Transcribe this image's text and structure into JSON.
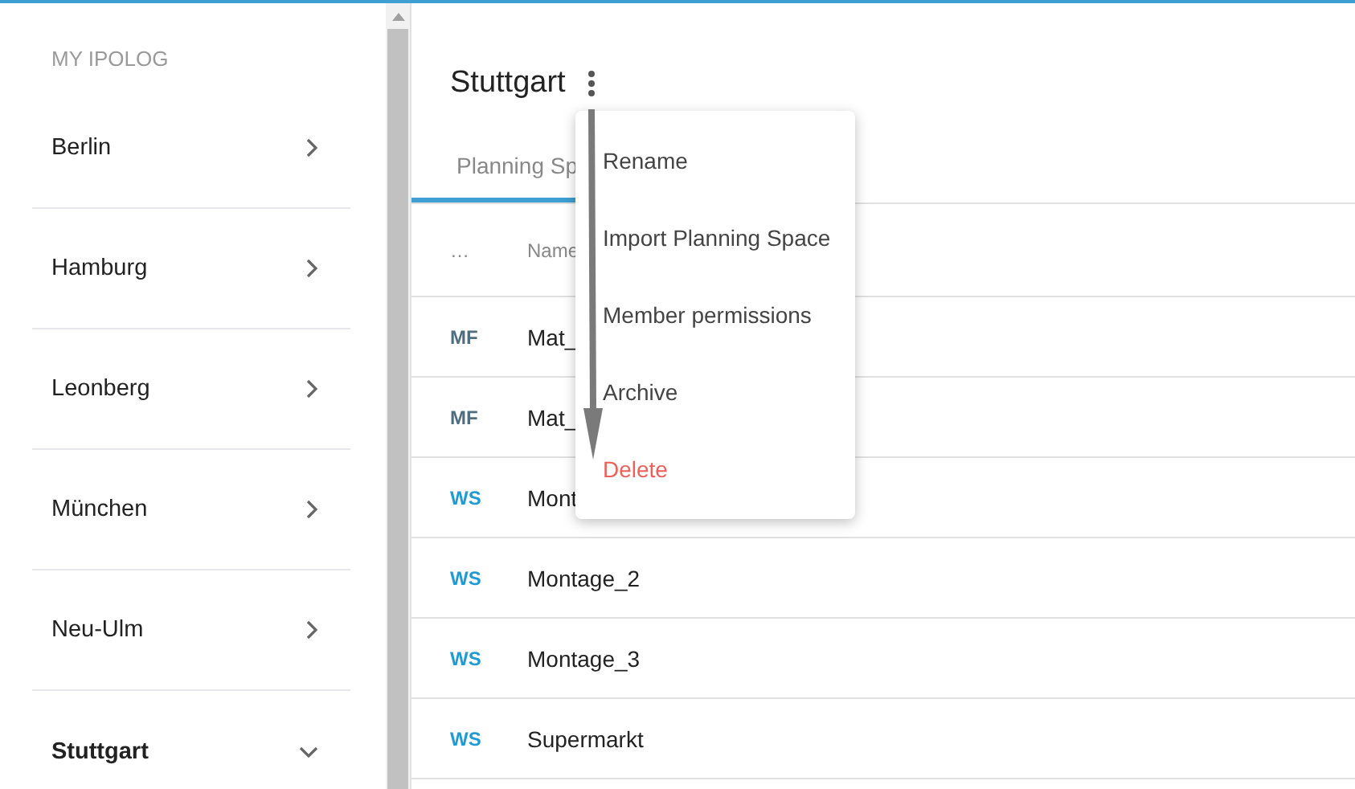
{
  "sidebar": {
    "heading": "MY IPOLOG",
    "items": [
      {
        "label": "Berlin",
        "expanded": false
      },
      {
        "label": "Hamburg",
        "expanded": false
      },
      {
        "label": "Leonberg",
        "expanded": false
      },
      {
        "label": "München",
        "expanded": false
      },
      {
        "label": "Neu-Ulm",
        "expanded": false
      },
      {
        "label": "Stuttgart",
        "expanded": true
      }
    ]
  },
  "page": {
    "title": "Stuttgart"
  },
  "tabs": [
    {
      "label": "Planning Sp",
      "selected": true
    }
  ],
  "table": {
    "columns": [
      "…",
      "Name"
    ],
    "rows": [
      {
        "kind": "MF",
        "name": "Mat_"
      },
      {
        "kind": "MF",
        "name": "Mat_"
      },
      {
        "kind": "WS",
        "name": "Mont"
      },
      {
        "kind": "WS",
        "name": "Montage_2"
      },
      {
        "kind": "WS",
        "name": "Montage_3"
      },
      {
        "kind": "WS",
        "name": "Supermarkt"
      }
    ]
  },
  "menu": {
    "items": [
      {
        "label": "Rename",
        "kind": "normal"
      },
      {
        "label": "Import Planning Space",
        "kind": "normal"
      },
      {
        "label": "Member permissions",
        "kind": "normal"
      },
      {
        "label": "Archive",
        "kind": "normal"
      },
      {
        "label": "Delete",
        "kind": "danger"
      }
    ]
  }
}
